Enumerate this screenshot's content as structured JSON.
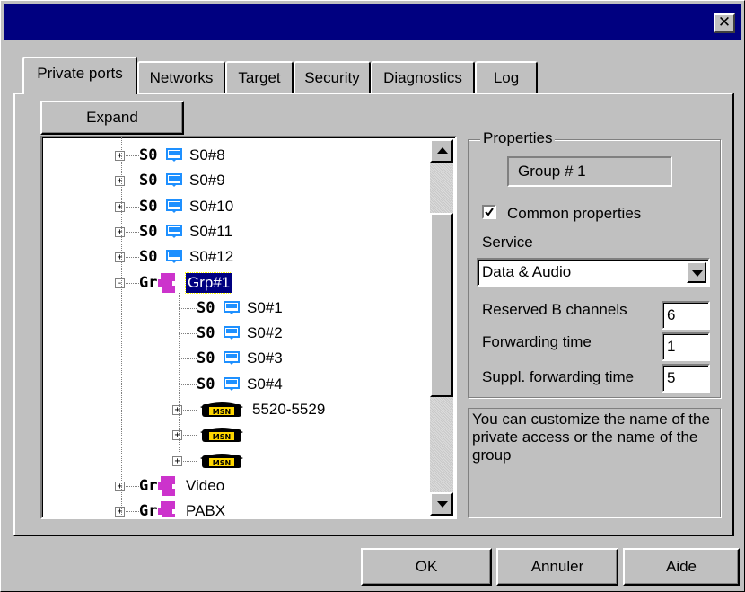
{
  "window": {
    "close_glyph": "✕"
  },
  "tabs": [
    {
      "label": "Private ports"
    },
    {
      "label": "Networks"
    },
    {
      "label": "Target"
    },
    {
      "label": "Security"
    },
    {
      "label": "Diagnostics"
    },
    {
      "label": "Log"
    }
  ],
  "expand_label": "Expand",
  "tree": [
    {
      "type": "S0",
      "label": "S0#8"
    },
    {
      "type": "S0",
      "label": "S0#9"
    },
    {
      "type": "S0",
      "label": "S0#10"
    },
    {
      "type": "S0",
      "label": "S0#11"
    },
    {
      "type": "S0",
      "label": "S0#12"
    },
    {
      "type": "Gr",
      "label": "Grp#1"
    },
    {
      "type": "S0",
      "label": "S0#1"
    },
    {
      "type": "S0",
      "label": "S0#2"
    },
    {
      "type": "S0",
      "label": "S0#3"
    },
    {
      "type": "S0",
      "label": "S0#4"
    },
    {
      "type": "MSN",
      "label": "5520-5529"
    },
    {
      "type": "MSN",
      "label": ""
    },
    {
      "type": "MSN",
      "label": ""
    },
    {
      "type": "Gr",
      "label": "Video"
    },
    {
      "type": "Gr",
      "label": "PABX"
    }
  ],
  "properties": {
    "title": "Properties",
    "name_value": "Group # 1",
    "common_label": "Common properties",
    "common_checked": true,
    "service_label": "Service",
    "service_value": "Data & Audio",
    "reserved_label": "Reserved B channels",
    "reserved_value": "6",
    "forwarding_label": "Forwarding time",
    "forwarding_value": "1",
    "suppl_label": "Suppl. forwarding time",
    "suppl_value": "5"
  },
  "info_text": "You can customize the name of the private access or the name of the group",
  "buttons": {
    "ok": "OK",
    "cancel": "Annuler",
    "help": "Aide"
  },
  "colors": {
    "title_bar": "#000080",
    "face": "#c0c0c0",
    "selection": "#000080",
    "group_icon": "#cc33cc",
    "port_icon": "#1e90ff"
  }
}
